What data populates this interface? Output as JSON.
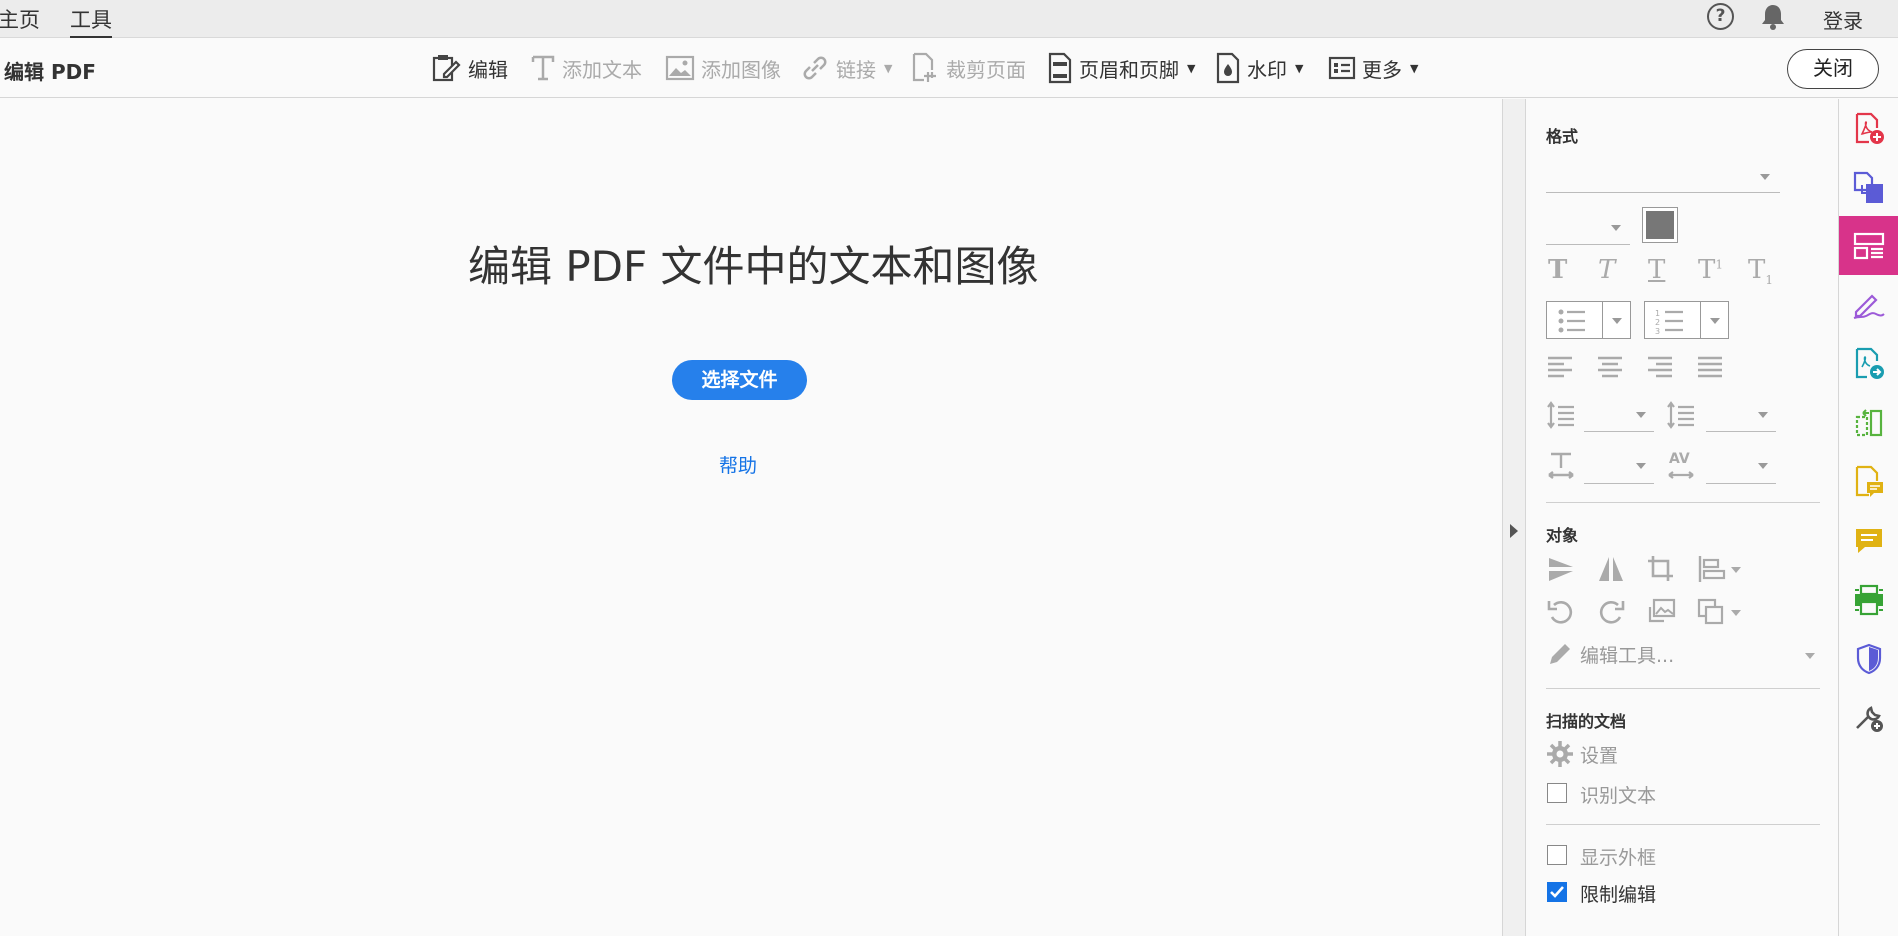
{
  "menubar": {
    "tabs": [
      {
        "label": "主页"
      },
      {
        "label": "工具"
      }
    ],
    "help_symbol": "?",
    "login": "登录"
  },
  "toolbar": {
    "title": "编辑 PDF",
    "buttons": [
      {
        "label": "编辑",
        "icon": "edit-icon",
        "enabled": true
      },
      {
        "label": "添加文本",
        "icon": "add-text-icon",
        "enabled": false
      },
      {
        "label": "添加图像",
        "icon": "add-image-icon",
        "enabled": false
      },
      {
        "label": "链接",
        "icon": "link-icon",
        "enabled": false
      },
      {
        "label": "裁剪页面",
        "icon": "crop-page-icon",
        "enabled": false
      },
      {
        "label": "页眉和页脚",
        "icon": "header-footer-icon",
        "enabled": true
      },
      {
        "label": "水印",
        "icon": "watermark-icon",
        "enabled": true
      },
      {
        "label": "更多",
        "icon": "more-icon",
        "enabled": true
      }
    ],
    "close": "关闭"
  },
  "main": {
    "heading": "编辑 PDF 文件中的文本和图像",
    "choose_file": "选择文件",
    "help": "帮助"
  },
  "panel": {
    "format_title": "格式",
    "object_title": "对象",
    "edit_tools": "编辑工具...",
    "scanned_title": "扫描的文档",
    "settings": "设置",
    "recognize_text": "识别文本",
    "show_bbox": "显示外框",
    "restrict_editing": "限制编辑",
    "restrict_editing_checked": true,
    "text_style_glyphs": [
      "T",
      "T",
      "T",
      "T",
      "T"
    ],
    "superscript": "1",
    "subscript": "1",
    "kerning_glyph": "AV"
  },
  "rail": {
    "icons": [
      {
        "name": "create-pdf-icon",
        "color": "#e3364a"
      },
      {
        "name": "combine-files-icon",
        "color": "#5b5bd6"
      },
      {
        "name": "edit-pdf-icon",
        "color": "#ffffff",
        "active": true
      },
      {
        "name": "fill-sign-icon",
        "color": "#9c5ad8"
      },
      {
        "name": "export-pdf-icon",
        "color": "#1a9db0"
      },
      {
        "name": "organize-pages-icon",
        "color": "#57b33e"
      },
      {
        "name": "comment-file-icon",
        "color": "#e0b213"
      },
      {
        "name": "comment-icon",
        "color": "#e0b213"
      },
      {
        "name": "print-production-icon",
        "color": "#37a335"
      },
      {
        "name": "protect-icon",
        "color": "#5b5bd6"
      },
      {
        "name": "more-tools-icon",
        "color": "#555555"
      }
    ]
  },
  "colors": {
    "primary_button": "#2680eb",
    "link": "#1473e6",
    "active_rail": "#d8338a"
  }
}
